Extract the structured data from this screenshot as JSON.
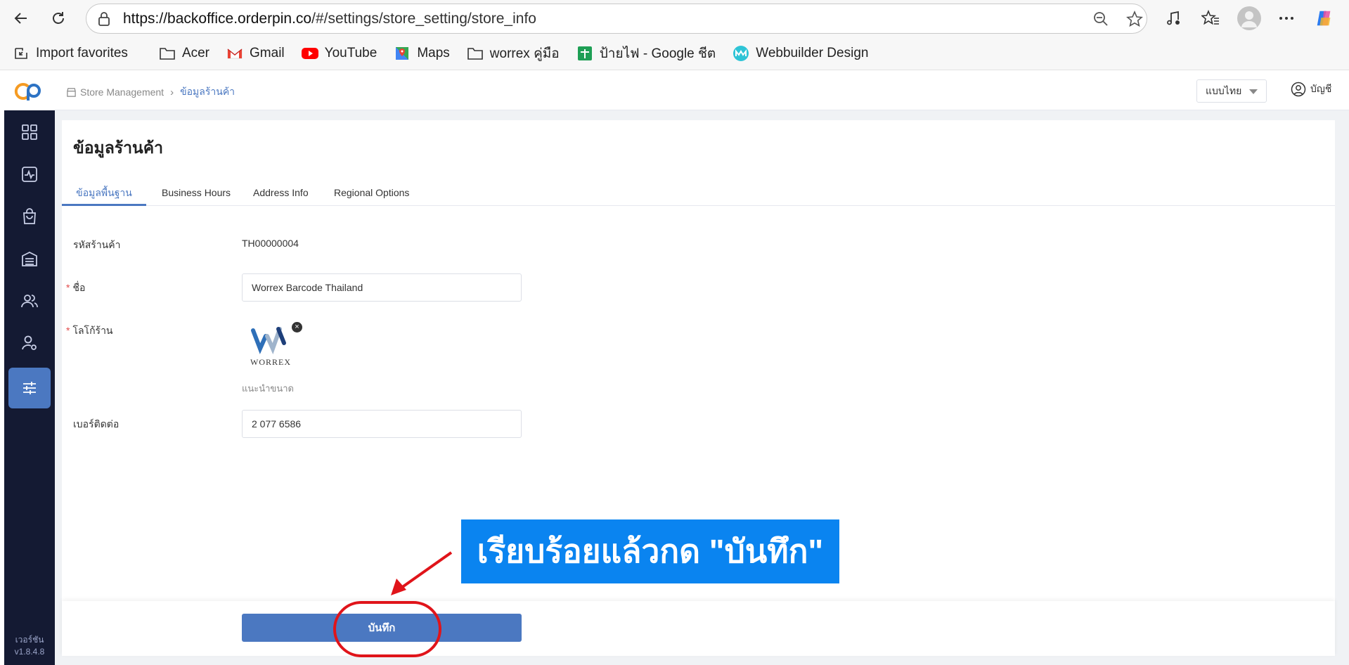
{
  "browser": {
    "url_host": "https://backoffice.orderpin.co",
    "url_path": "/#/settings/store_setting/store_info",
    "bookmarks": [
      {
        "label": "Import favorites",
        "icon": "import-icon"
      },
      {
        "label": "Acer",
        "icon": "folder-icon"
      },
      {
        "label": "Gmail",
        "icon": "gmail-icon"
      },
      {
        "label": "YouTube",
        "icon": "youtube-icon"
      },
      {
        "label": "Maps",
        "icon": "maps-icon"
      },
      {
        "label": "worrex คู่มือ",
        "icon": "folder-icon"
      },
      {
        "label": "ป้ายไฟ - Google ชีต",
        "icon": "sheets-icon"
      },
      {
        "label": "Webbuilder Design",
        "icon": "webbuilder-icon"
      }
    ]
  },
  "header": {
    "breadcrumb_root": "Store Management",
    "breadcrumb_current": "ข้อมูลร้านค้า",
    "language": "แบบไทย",
    "account": "บัญชี"
  },
  "sidebar": {
    "items": [
      {
        "icon": "dashboard-icon",
        "active": false
      },
      {
        "icon": "activity-icon",
        "active": false
      },
      {
        "icon": "shopping-bag-icon",
        "active": false
      },
      {
        "icon": "warehouse-icon",
        "active": false
      },
      {
        "icon": "customers-icon",
        "active": false
      },
      {
        "icon": "user-settings-icon",
        "active": false
      },
      {
        "icon": "sliders-icon",
        "active": true
      }
    ],
    "version_label": "เวอร์ชัน",
    "version": "v1.8.4.8"
  },
  "page": {
    "title": "ข้อมูลร้านค้า",
    "tabs": [
      {
        "label": "ข้อมูลพื้นฐาน",
        "active": true
      },
      {
        "label": "Business Hours",
        "active": false
      },
      {
        "label": "Address Info",
        "active": false
      },
      {
        "label": "Regional Options",
        "active": false
      }
    ],
    "form": {
      "store_code_label": "รหัสร้านค้า",
      "store_code": "TH00000004",
      "name_label": "ชื่อ",
      "name_value": "Worrex Barcode Thailand",
      "logo_label": "โลโก้ร้าน",
      "logo_text": "WORREX",
      "logo_hint": "แนะนำขนาด",
      "phone_label": "เบอร์ติดต่อ",
      "phone_value": "2 077 6586",
      "required_mark": "*"
    },
    "save_label": "บันทึก"
  },
  "annotation": {
    "callout_text": "เรียบร้อยแล้วกด \"บันทึก\"",
    "color": "#0a84f0",
    "highlight_color": "#e0141a"
  },
  "colors": {
    "primary": "#4b78c1",
    "sidebar_bg": "#141a33",
    "required": "#e24b4b"
  }
}
